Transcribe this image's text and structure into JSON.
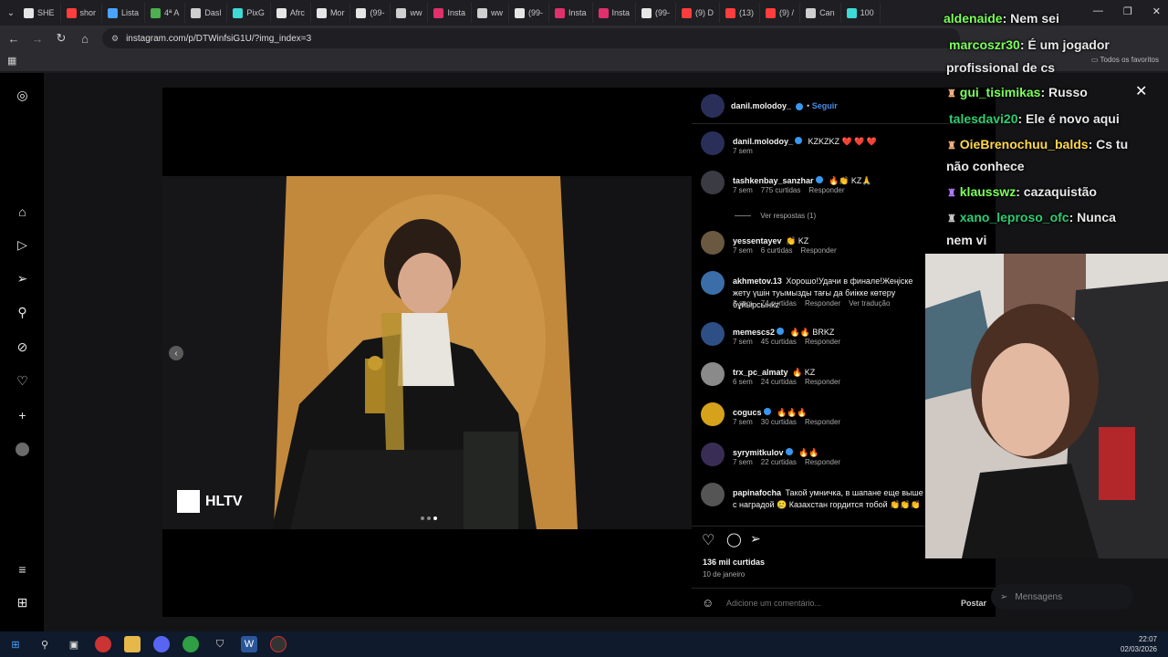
{
  "browser": {
    "tabs": [
      {
        "label": "SHE",
        "color": "#e6e6e6"
      },
      {
        "label": "shor",
        "color": "#ff3d3d"
      },
      {
        "label": "Lista",
        "color": "#4aa3ff"
      },
      {
        "label": "4ª A",
        "color": "#4caf50"
      },
      {
        "label": "Dasl",
        "color": "#cfcfcf"
      },
      {
        "label": "PixG",
        "color": "#3ddad7"
      },
      {
        "label": "Afrc",
        "color": "#e6e6e6"
      },
      {
        "label": "Mor",
        "color": "#e6e6e6"
      },
      {
        "label": "(99-",
        "color": "#e6e6e6"
      },
      {
        "label": "ww",
        "color": "#cfcfcf"
      },
      {
        "label": "Insta",
        "color": "#e1306c"
      },
      {
        "label": "ww",
        "color": "#cfcfcf"
      },
      {
        "label": "(99-",
        "color": "#e6e6e6"
      },
      {
        "label": "Insta",
        "color": "#e1306c"
      },
      {
        "label": "Insta",
        "color": "#e1306c"
      },
      {
        "label": "(99-",
        "color": "#e6e6e6"
      },
      {
        "label": "(9) D",
        "color": "#ff3d3d"
      },
      {
        "label": "(13)",
        "color": "#ff3d3d"
      },
      {
        "label": "(9) /",
        "color": "#ff3d3d"
      },
      {
        "label": "Can",
        "color": "#cfcfcf"
      },
      {
        "label": "100",
        "color": "#3ddad7"
      }
    ],
    "url": "instagram.com/p/DTWinfsiG1U/?img_index=3",
    "bookmarks_label": "Todos os favoritos"
  },
  "post": {
    "author": "danil.molodoy_",
    "follow_label": "Seguir",
    "photo_watermark": "HLTV",
    "likes": "136 mil curtidas",
    "date": "10 de janeiro",
    "comment_placeholder": "Adicione um comentário...",
    "post_button": "Postar"
  },
  "comments": [
    {
      "user": "danil.molodoy_",
      "text": "KZKZKZ ❤️ ❤️ ❤️",
      "time": "7 sem",
      "likes": "",
      "reply": "",
      "translate": "",
      "avatar": "#2a2f5a",
      "verified": true
    },
    {
      "user": "tashkenbay_sanzhar",
      "text": "🔥👏 KZ🙏",
      "time": "7 sem",
      "likes": "775 curtidas",
      "reply": "Responder",
      "translate": "",
      "avatar": "#3b3b44",
      "verified": true
    },
    {
      "user": "yessentayev",
      "text": "👏 KZ",
      "time": "7 sem",
      "likes": "6 curtidas",
      "reply": "Responder",
      "translate": "",
      "avatar": "#6a5840",
      "verified": false
    },
    {
      "user": "akhmetov.13",
      "text": "Хорошо!Удачи в финале!Жеңіске жету үшін туымызды тағы да биікке көтеру бұйырсынkz",
      "time": "3 sem",
      "likes": "74 curtidas",
      "reply": "Responder",
      "translate": "Ver tradução",
      "avatar": "#3b6ea8",
      "verified": false
    },
    {
      "user": "memescs2",
      "text": "🔥🔥 BRKZ",
      "time": "7 sem",
      "likes": "45 curtidas",
      "reply": "Responder",
      "translate": "",
      "avatar": "#2d4f86",
      "verified": true
    },
    {
      "user": "trx_pc_almaty",
      "text": "🔥 KZ",
      "time": "6 sem",
      "likes": "24 curtidas",
      "reply": "Responder",
      "translate": "",
      "avatar": "#8a8a8a",
      "verified": false
    },
    {
      "user": "cogucs",
      "text": "🔥🔥🔥",
      "time": "7 sem",
      "likes": "30 curtidas",
      "reply": "Responder",
      "translate": "",
      "avatar": "#d6a21b",
      "verified": true
    },
    {
      "user": "syrymitkulov",
      "text": "🔥🔥",
      "time": "7 sem",
      "likes": "22 curtidas",
      "reply": "Responder",
      "translate": "",
      "avatar": "#3a2d55",
      "verified": true
    },
    {
      "user": "papinafocha",
      "text": "Такой умничка, в шапане еще выше с наградой 🥲 Казахстан гордится тобой 👏👏👏",
      "time": "",
      "likes": "",
      "reply": "",
      "translate": "",
      "avatar": "#555555",
      "verified": false
    }
  ],
  "replies_label": "Ver respostas (1)",
  "chat": [
    {
      "user": "aldenaide",
      "msg": ": Nem sei",
      "color": "#7cff5a"
    },
    {
      "user": "marcoszr30",
      "msg": ": É um jogador",
      "msg2": "profissional de cs",
      "color": "#7cff5a"
    },
    {
      "user": "gui_tisimikas",
      "msg": ": Russo",
      "color": "#7cff5a"
    },
    {
      "user": "talesdavi20",
      "msg": ": Ele é novo aqui",
      "color": "#2ecc71"
    },
    {
      "user": "OieBrenochuu_balds",
      "msg": ": Cs tu",
      "msg2": "não conhece",
      "color": "#ffd84a"
    },
    {
      "user": "klausswz",
      "msg": ": cazaquistão",
      "color": "#7cff5a"
    },
    {
      "user": "xano_leproso_ofc",
      "msg": ": Nunca",
      "msg2": "nem vi",
      "color": "#2ecc71"
    }
  ],
  "messages_label": "Mensagens",
  "taskbar": {
    "time": "22:07",
    "date": "02/03/2026"
  }
}
